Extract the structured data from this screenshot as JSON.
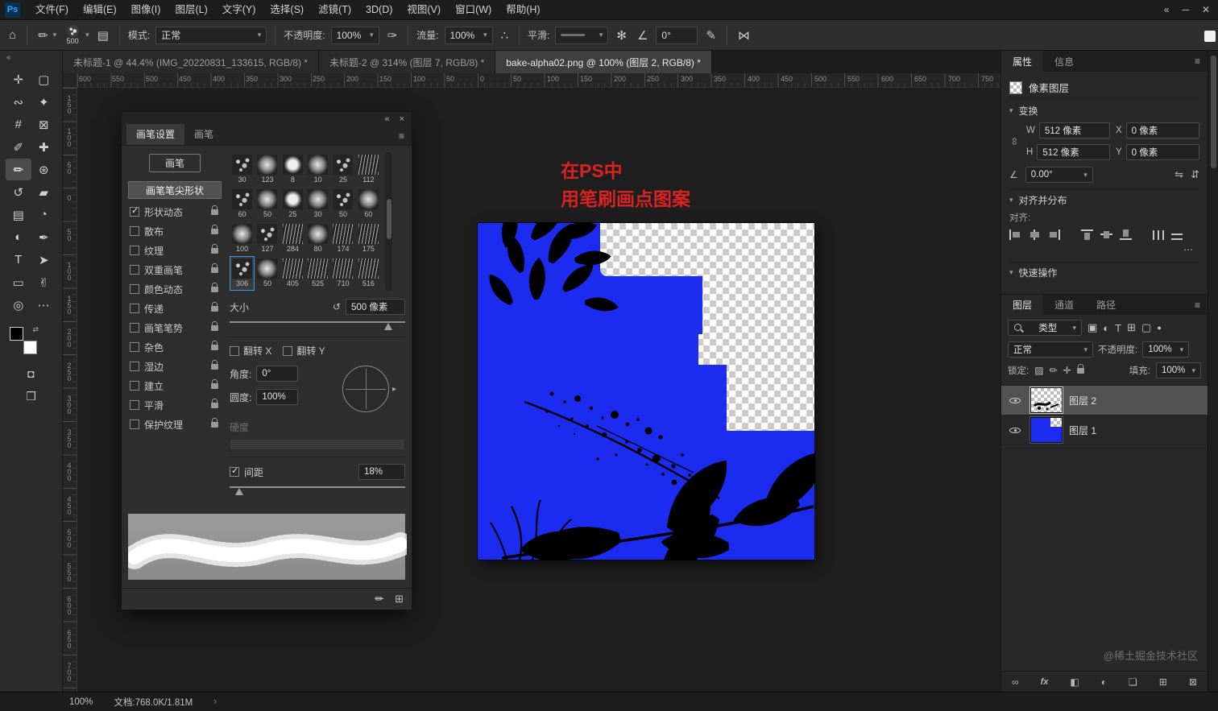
{
  "window": {
    "logo_text": "Ps",
    "controls": {
      "collapse": "«",
      "minimize": "─",
      "close": "✕"
    }
  },
  "menu_bar": {
    "items": [
      "文件(F)",
      "编辑(E)",
      "图像(I)",
      "图层(L)",
      "文字(Y)",
      "选择(S)",
      "滤镜(T)",
      "3D(D)",
      "视图(V)",
      "窗口(W)",
      "帮助(H)"
    ]
  },
  "options_bar": {
    "icons": {
      "home": "⌂",
      "tool_brush": "✏",
      "panel_toggle": "▤",
      "pressure_opacity": "✑",
      "airbrush": "∴",
      "gear": "✻",
      "angle": "∠",
      "pressure_size": "✎",
      "symmetry": "⋈",
      "dropdown": "▾"
    },
    "brush_preset_size": "500",
    "mode_label": "模式:",
    "mode_value": "正常",
    "opacity_label": "不透明度:",
    "opacity_value": "100%",
    "flow_label": "流量:",
    "flow_value": "100%",
    "smoothing_label": "平滑:",
    "angle_value": "0°"
  },
  "document_tabs": [
    {
      "label": "未标题-1 @ 44.4% (IMG_20220831_133615, RGB/8) *"
    },
    {
      "label": "未标题-2 @ 314% (图层 7, RGB/8) *"
    },
    {
      "label": "bake-alpha02.png @ 100% (图层 2, RGB/8) *"
    }
  ],
  "rulers": {
    "horizontal": [
      "600",
      "550",
      "500",
      "450",
      "400",
      "350",
      "300",
      "250",
      "200",
      "150",
      "100",
      "50",
      "0",
      "50",
      "100",
      "150",
      "200",
      "250",
      "300",
      "350",
      "400",
      "450",
      "500",
      "550",
      "600",
      "650",
      "700",
      "750"
    ],
    "vertical": [
      "150",
      "100",
      "50",
      "0",
      "50",
      "100",
      "150",
      "200",
      "250",
      "300",
      "350",
      "400",
      "450",
      "500",
      "550",
      "600",
      "650",
      "700"
    ]
  },
  "tools": [
    {
      "name": "move-tool",
      "glyph": "✛"
    },
    {
      "name": "marquee-tool",
      "glyph": "▢"
    },
    {
      "name": "lasso-tool",
      "glyph": "∾"
    },
    {
      "name": "object-selection-tool",
      "glyph": "✦"
    },
    {
      "name": "crop-tool",
      "glyph": "#"
    },
    {
      "name": "frame-tool",
      "glyph": "⊠"
    },
    {
      "name": "eyedropper-tool",
      "glyph": "✐"
    },
    {
      "name": "healing-brush-tool",
      "glyph": "✚"
    },
    {
      "name": "brush-tool",
      "glyph": "✏"
    },
    {
      "name": "clone-stamp-tool",
      "glyph": "⊛"
    },
    {
      "name": "history-brush-tool",
      "glyph": "↺"
    },
    {
      "name": "eraser-tool",
      "glyph": "▰"
    },
    {
      "name": "gradient-tool",
      "glyph": "▤"
    },
    {
      "name": "blur-tool",
      "glyph": "◔"
    },
    {
      "name": "dodge-tool",
      "glyph": "◐"
    },
    {
      "name": "pen-tool",
      "glyph": "✒"
    },
    {
      "name": "type-tool",
      "glyph": "T"
    },
    {
      "name": "path-selection-tool",
      "glyph": "➤"
    },
    {
      "name": "rectangle-tool",
      "glyph": "▭"
    },
    {
      "name": "hand-tool",
      "glyph": "✌"
    },
    {
      "name": "zoom-tool",
      "glyph": "◎"
    },
    {
      "name": "edit-toolbar",
      "glyph": "⋯"
    }
  ],
  "tools_extra": {
    "quick_mask": "◘",
    "screen_mode": "❒",
    "swap": "⇄",
    "fg_color": "#000000",
    "bg_color": "#ffffff"
  },
  "brush_settings_panel": {
    "header_icons": {
      "collapse": "«",
      "close": "×",
      "menu": "≡"
    },
    "tabs": [
      {
        "label": "画笔设置",
        "active": true
      },
      {
        "label": "画笔",
        "active": false
      }
    ],
    "brush_button": "画笔",
    "tip_shape_label": "画笔笔尖形状",
    "options": [
      {
        "label": "形状动态",
        "checked": true
      },
      {
        "label": "散布",
        "checked": false
      },
      {
        "label": "纹理",
        "checked": false
      },
      {
        "label": "双重画笔",
        "checked": false
      },
      {
        "label": "颜色动态",
        "checked": false
      },
      {
        "label": "传递",
        "checked": false
      },
      {
        "label": "画笔笔势",
        "checked": false
      },
      {
        "label": "杂色",
        "checked": false
      },
      {
        "label": "湿边",
        "checked": false
      },
      {
        "label": "建立",
        "checked": false
      },
      {
        "label": "平滑",
        "checked": false
      },
      {
        "label": "保护纹理",
        "checked": false
      }
    ],
    "presets": [
      "30",
      "123",
      "8",
      "10",
      "25",
      "112",
      "60",
      "50",
      "25",
      "30",
      "50",
      "60",
      "100",
      "127",
      "284",
      "80",
      "174",
      "175",
      "306",
      "50",
      "405",
      "525",
      "710",
      "516"
    ],
    "selected_preset": "306",
    "size_label": "大小",
    "size_value": "500 像素",
    "reset_icon": "↺",
    "flip_x_label": "翻转 X",
    "flip_y_label": "翻转 Y",
    "angle_label": "角度:",
    "angle_value": "0°",
    "roundness_label": "圆度:",
    "roundness_value": "100%",
    "hardness_label": "硬度",
    "spacing_label": "间距",
    "spacing_value": "18%",
    "spacing_checked": true,
    "dial_arrow": "▸",
    "footer_icons": {
      "preview_toggle": "✏",
      "new_brush": "⊞"
    }
  },
  "canvas": {
    "annotation": [
      "在PS中",
      "用笔刷画点图案"
    ],
    "annotation_color": "#d92222",
    "blue": "#1b2cf0"
  },
  "properties_panel": {
    "tabs": [
      {
        "label": "属性",
        "active": true
      },
      {
        "label": "信息",
        "active": false
      }
    ],
    "menu_icon": "≡",
    "layer_type": "像素图层",
    "transform_title": "变换",
    "chevron": "▾",
    "link_icon": "∞",
    "fields": {
      "w_label": "W",
      "w_value": "512 像素",
      "x_label": "X",
      "x_value": "0 像素",
      "h_label": "H",
      "h_value": "512 像素",
      "y_label": "Y",
      "y_value": "0 像素",
      "angle_icon": "∠",
      "angle_value": "0.00°",
      "flip_h": "⇋",
      "flip_v": "⇵"
    },
    "align_title": "对齐并分布",
    "align_label": "对齐:",
    "more_icon": "⋯",
    "quick_title": "快速操作"
  },
  "layers_panel": {
    "tabs": [
      {
        "label": "图层",
        "active": true
      },
      {
        "label": "通道",
        "active": false
      },
      {
        "label": "路径",
        "active": false
      }
    ],
    "menu_icon": "≡",
    "filter_label": "类型",
    "filter_icons": [
      "▣",
      "◐",
      "T",
      "⊞",
      "▢"
    ],
    "filter_toggle": "●",
    "blend_mode": "正常",
    "opacity_label": "不透明度:",
    "opacity_value": "100%",
    "lock_label": "锁定:",
    "lock_icons": [
      "▨",
      "✏",
      "✛"
    ],
    "fill_label": "填充:",
    "fill_value": "100%",
    "layers": [
      {
        "name": "图层 2",
        "selected": true
      },
      {
        "name": "图层 1",
        "selected": false
      }
    ],
    "bottom_icons": [
      {
        "name": "link-layers-icon",
        "glyph": "∞"
      },
      {
        "name": "layer-effects-icon",
        "glyph": "fx"
      },
      {
        "name": "layer-mask-icon",
        "glyph": "◧"
      },
      {
        "name": "adjustment-layer-icon",
        "glyph": "◐"
      },
      {
        "name": "layer-group-icon",
        "glyph": "❏"
      },
      {
        "name": "new-layer-icon",
        "glyph": "⊞"
      },
      {
        "name": "delete-layer-icon",
        "glyph": "⊠"
      }
    ]
  },
  "status_bar": {
    "zoom": "100%",
    "doc_info": "文档:768.0K/1.81M",
    "chevron": "›"
  },
  "watermark": "@稀土掘金技术社区"
}
